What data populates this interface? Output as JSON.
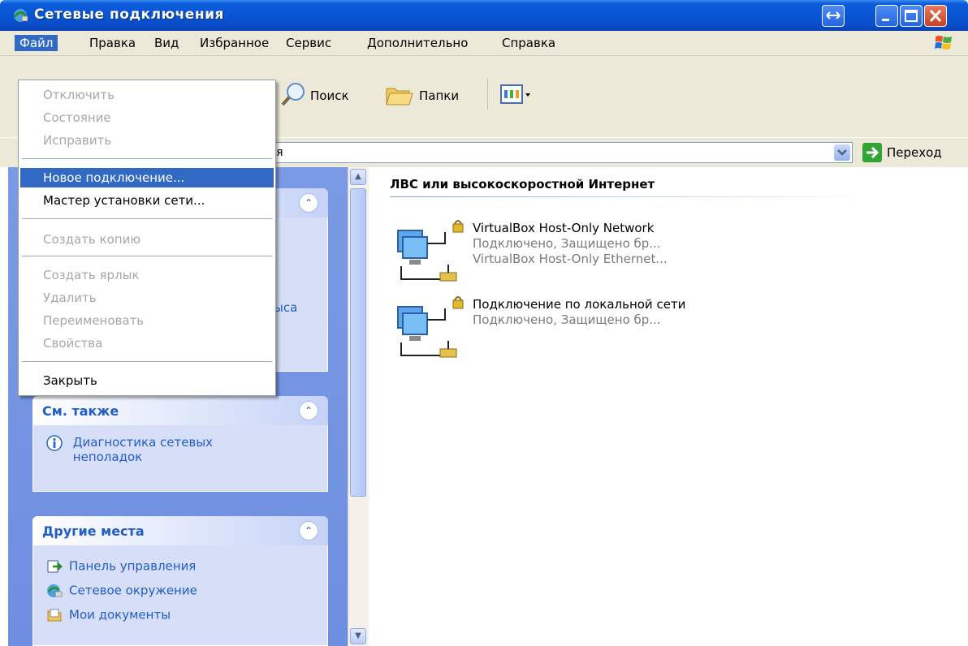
{
  "window": {
    "title": "Сетевые подключения"
  },
  "menubar": {
    "items": [
      "Файл",
      "Правка",
      "Вид",
      "Избранное",
      "Сервис",
      "Дополнительно",
      "Справка"
    ]
  },
  "toolbar": {
    "search_label": "Поиск",
    "folders_label": "Папки"
  },
  "address": {
    "value_partial": "ия",
    "go_label": "Переход"
  },
  "file_menu": {
    "items": [
      {
        "label": "Отключить",
        "enabled": false
      },
      {
        "label": "Состояние",
        "enabled": false
      },
      {
        "label": "Исправить",
        "enabled": false
      },
      {
        "label": "Новое подключение...",
        "enabled": true,
        "highlighted": true
      },
      {
        "label": "Мастер установки сети...",
        "enabled": true
      },
      {
        "label": "Создать копию",
        "enabled": false
      },
      {
        "label": "Создать ярлык",
        "enabled": false
      },
      {
        "label": "Удалить",
        "enabled": false
      },
      {
        "label": "Переименовать",
        "enabled": false
      },
      {
        "label": "Свойства",
        "enabled": false
      },
      {
        "label": "Закрыть",
        "enabled": true
      }
    ]
  },
  "left_pane": {
    "partial_text": "ыса",
    "see_also": {
      "title": "См. также",
      "links": [
        "Диагностика сетевых неполадок"
      ]
    },
    "other_places": {
      "title": "Другие места",
      "links": [
        "Панель управления",
        "Сетевое окружение",
        "Мои документы"
      ]
    }
  },
  "content": {
    "group_title": "ЛВС или высокоскоростной Интернет",
    "connections": [
      {
        "name": "VirtualBox Host-Only Network",
        "status": "Подключено, Защищено бр...",
        "device": "VirtualBox Host-Only Ethernet..."
      },
      {
        "name": "Подключение по локальной сети",
        "status": "Подключено, Защищено бр..."
      }
    ]
  },
  "colors": {
    "titlebar": "#0a55d3",
    "menu_highlight": "#316ac5",
    "task_pane": "#6e8ee0",
    "link_blue": "#215dc6"
  }
}
